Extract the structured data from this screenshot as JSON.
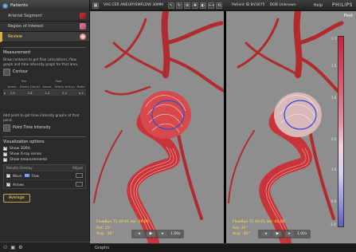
{
  "app": {
    "title": "Patients"
  },
  "workflow_steps": [
    {
      "label": "Arterial Segment",
      "icon": "artery-icon",
      "active": false
    },
    {
      "label": "Region of Interest",
      "icon": "hand-icon",
      "active": false
    },
    {
      "label": "Review",
      "icon": "review-icon",
      "active": true
    }
  ],
  "measurement": {
    "title": "Measurement",
    "description": "Draw contours to get flow calculations, flow graph and time intensity graph for that area.",
    "contour_label": "Contour",
    "table": {
      "group_headers": [
        "Pre",
        "Post"
      ],
      "columns": [
        "Aneur.",
        "Artery (mL/s)",
        "Aneur.",
        "Artery (mL/s)",
        "Ratio"
      ],
      "rows": [
        [
          "2.9",
          "2.8",
          "1.2",
          "2.2",
          "0.4"
        ]
      ]
    },
    "tig_description": "Add point to get time intensity graphs at that point.",
    "tig_label": "Point Time Intensity"
  },
  "visualization": {
    "title": "Visualization options",
    "options": [
      {
        "label": "Show 3DRA",
        "checked": true
      },
      {
        "label": "Show X-ray series",
        "checked": true
      },
      {
        "label": "Show measurements",
        "checked": true
      }
    ],
    "overlay": {
      "header_left": "Results Overlay",
      "header_right": "Adjust",
      "rows": [
        {
          "label": "Wave",
          "extra": "Flow"
        },
        {
          "label": "Arrows",
          "extra": ""
        }
      ]
    },
    "average_label": "Average"
  },
  "toolbar": {
    "series_title": "VAS CER ANEURYSMFLOW 30MM",
    "patient_id": "Patient ID 8V3075",
    "dob": "DOB Unknown",
    "help": "Help",
    "brand": "PHILIPS"
  },
  "views": {
    "left": {
      "label": "Pre",
      "frame_info": "FlowRun T1 00:01  Vol: 00.00",
      "angles": [
        "Rot: 35°",
        "Ang: -30°"
      ],
      "zoom": "1.00x"
    },
    "right": {
      "label": "Post",
      "frame_info": "FlowRun T1 00:01  Vol: 00.00",
      "angles": [
        "Rot: 35°",
        "Ang: -30°"
      ],
      "zoom": "1.00x"
    }
  },
  "colorbar": {
    "labels": [
      "1.7",
      "1.5",
      "1.0",
      "0.5",
      "1.0",
      "0.0",
      "-1.0"
    ]
  },
  "bottom": {
    "tab": "Graphs"
  },
  "colors": {
    "accent": "#ffd84a",
    "vessel": "#c8343a",
    "contour": "#3a4bd8"
  }
}
